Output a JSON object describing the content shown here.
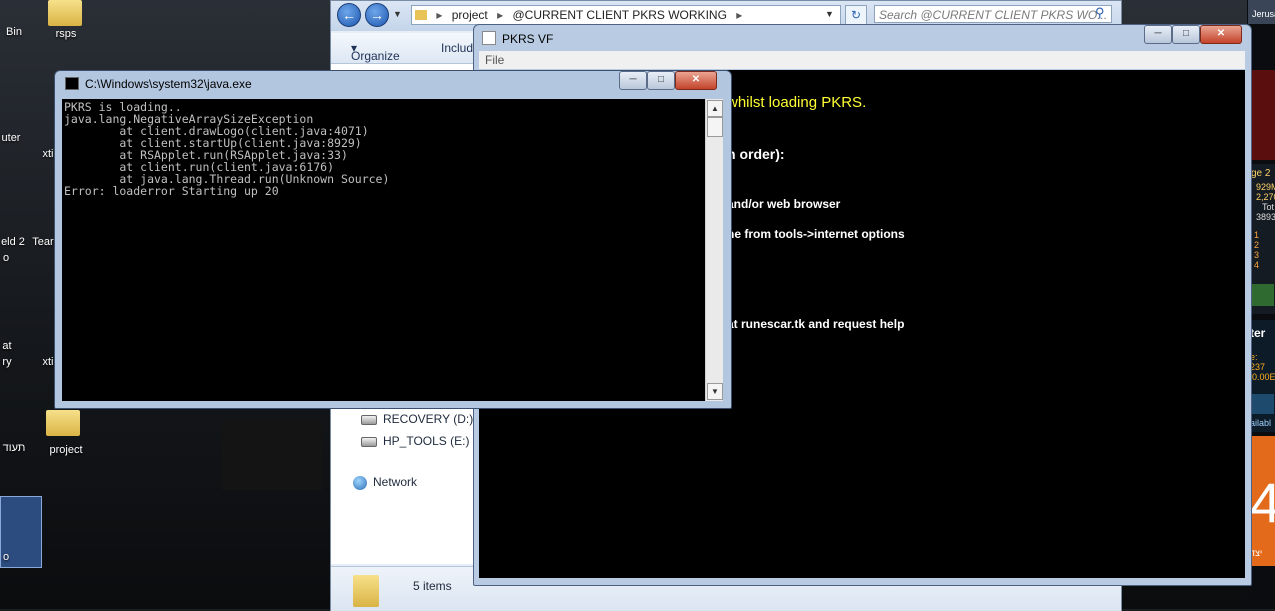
{
  "desktop": {
    "icons": [
      {
        "label": "Bin"
      },
      {
        "label": "rsps"
      },
      {
        "label": "uter"
      },
      {
        "label": "xti"
      },
      {
        "label": "Tear"
      },
      {
        "label": "eld 2"
      },
      {
        "label": "o"
      },
      {
        "label": "at"
      },
      {
        "label": "ry"
      },
      {
        "label": "xti"
      },
      {
        "label": "project"
      },
      {
        "label": "תעוד"
      },
      {
        "label": "o"
      }
    ],
    "gadgets": {
      "clock_city": "Jerusal",
      "cpu_label": "ge 2",
      "cpu_val1": "929M",
      "cpu_val2": "2,270",
      "cpu_total": "Tot",
      "cpu_val3": "3893",
      "core_list": [
        "1",
        "2",
        "3",
        "4"
      ],
      "net_label": "ter",
      "net_val1": "e: 237",
      "net_val2": "0.00E",
      "net_avail": "ailabl",
      "cal_day": "4",
      "cal_bottom": "יצד"
    }
  },
  "explorer": {
    "address_parts": [
      "project",
      "@CURRENT CLIENT PKRS WORKING"
    ],
    "search_placeholder": "Search @CURRENT CLIENT PKRS WO...",
    "toolbar": {
      "organize": "Organize",
      "include": "Includ"
    },
    "nav": {
      "drive1": "RECOVERY (D:)",
      "drive2": "HP_TOOLS (E:)",
      "network": "Network"
    },
    "status": "5 items"
  },
  "pkrs_window": {
    "title": "PKRS VF",
    "menu_file": "File",
    "messages": {
      "line1": "whilst loading PKRS.",
      "line2": "n order):",
      "line3": "and/or web browser",
      "line4": "he from tools->internet options",
      "line5": "at runescar.tk and request help"
    }
  },
  "console_window": {
    "title": "C:\\Windows\\system32\\java.exe",
    "lines": [
      "PKRS is loading..",
      "java.lang.NegativeArraySizeException",
      "        at client.drawLogo(client.java:4071)",
      "        at client.startUp(client.java:8929)",
      "        at RSApplet.run(RSApplet.java:33)",
      "        at client.run(client.java:6176)",
      "        at java.lang.Thread.run(Unknown Source)",
      "Error: loaderror Starting up 20"
    ]
  },
  "icons": {
    "back": "back-arrow-icon",
    "forward": "forward-arrow-icon",
    "search": "magnifier-icon",
    "minimize": "minimize-icon",
    "maximize": "maximize-icon",
    "close": "close-icon"
  }
}
